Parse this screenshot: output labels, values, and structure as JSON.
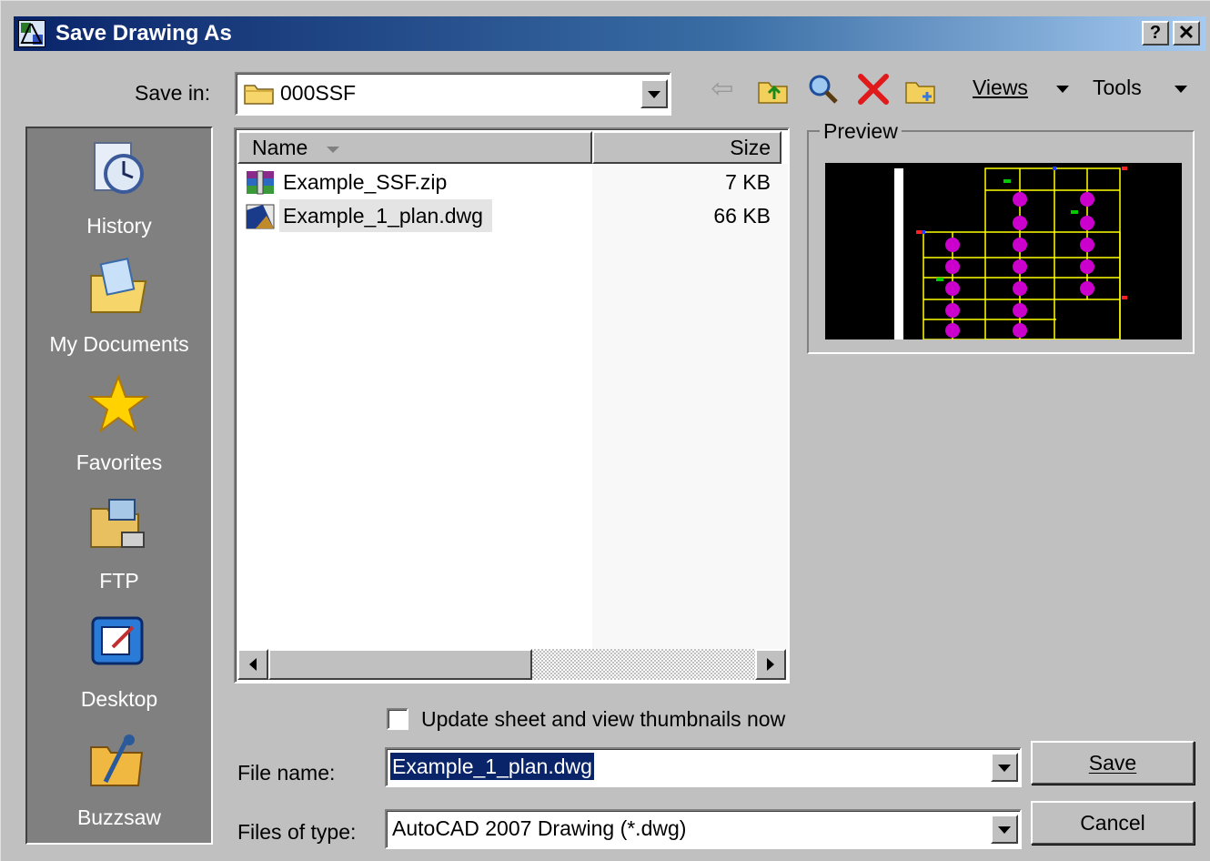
{
  "window": {
    "title": "Save Drawing As",
    "help_button": "?",
    "close_button": "✕"
  },
  "toolbar": {
    "save_in_label": "Save in:",
    "save_in_value": "000SSF",
    "back_icon": "back-arrow-icon",
    "up_icon": "up-folder-icon",
    "search_icon": "search-web-icon",
    "delete_icon": "delete-icon",
    "new_folder_icon": "new-folder-icon",
    "views_label": "Views",
    "tools_label": "Tools"
  },
  "places": [
    {
      "label": "History",
      "icon": "history-icon"
    },
    {
      "label": "My Documents",
      "icon": "my-documents-icon"
    },
    {
      "label": "Favorites",
      "icon": "favorites-icon"
    },
    {
      "label": "FTP",
      "icon": "ftp-icon"
    },
    {
      "label": "Desktop",
      "icon": "desktop-icon"
    },
    {
      "label": "Buzzsaw",
      "icon": "buzzsaw-icon"
    }
  ],
  "file_list": {
    "columns": [
      "Name",
      "Size"
    ],
    "rows": [
      {
        "name": "Example_SSF.zip",
        "size": "7 KB",
        "icon": "zip-archive-icon"
      },
      {
        "name": "Example_1_plan.dwg",
        "size": "66 KB",
        "icon": "dwg-file-icon",
        "selected": true
      }
    ]
  },
  "preview": {
    "label": "Preview"
  },
  "thumbnail_checkbox": {
    "label": "Update sheet and view thumbnails now",
    "checked": false
  },
  "file_name": {
    "label": "File name:",
    "value": "Example_1_plan.dwg"
  },
  "file_type": {
    "label": "Files of type:",
    "value": "AutoCAD 2007 Drawing (*.dwg)"
  },
  "buttons": {
    "save": "Save",
    "cancel": "Cancel"
  },
  "colors": {
    "title_start": "#0a246a",
    "title_end": "#a6caf0",
    "dialog_bg": "#c0c0c0",
    "places_bg": "#808080",
    "selection": "#0a246a"
  }
}
